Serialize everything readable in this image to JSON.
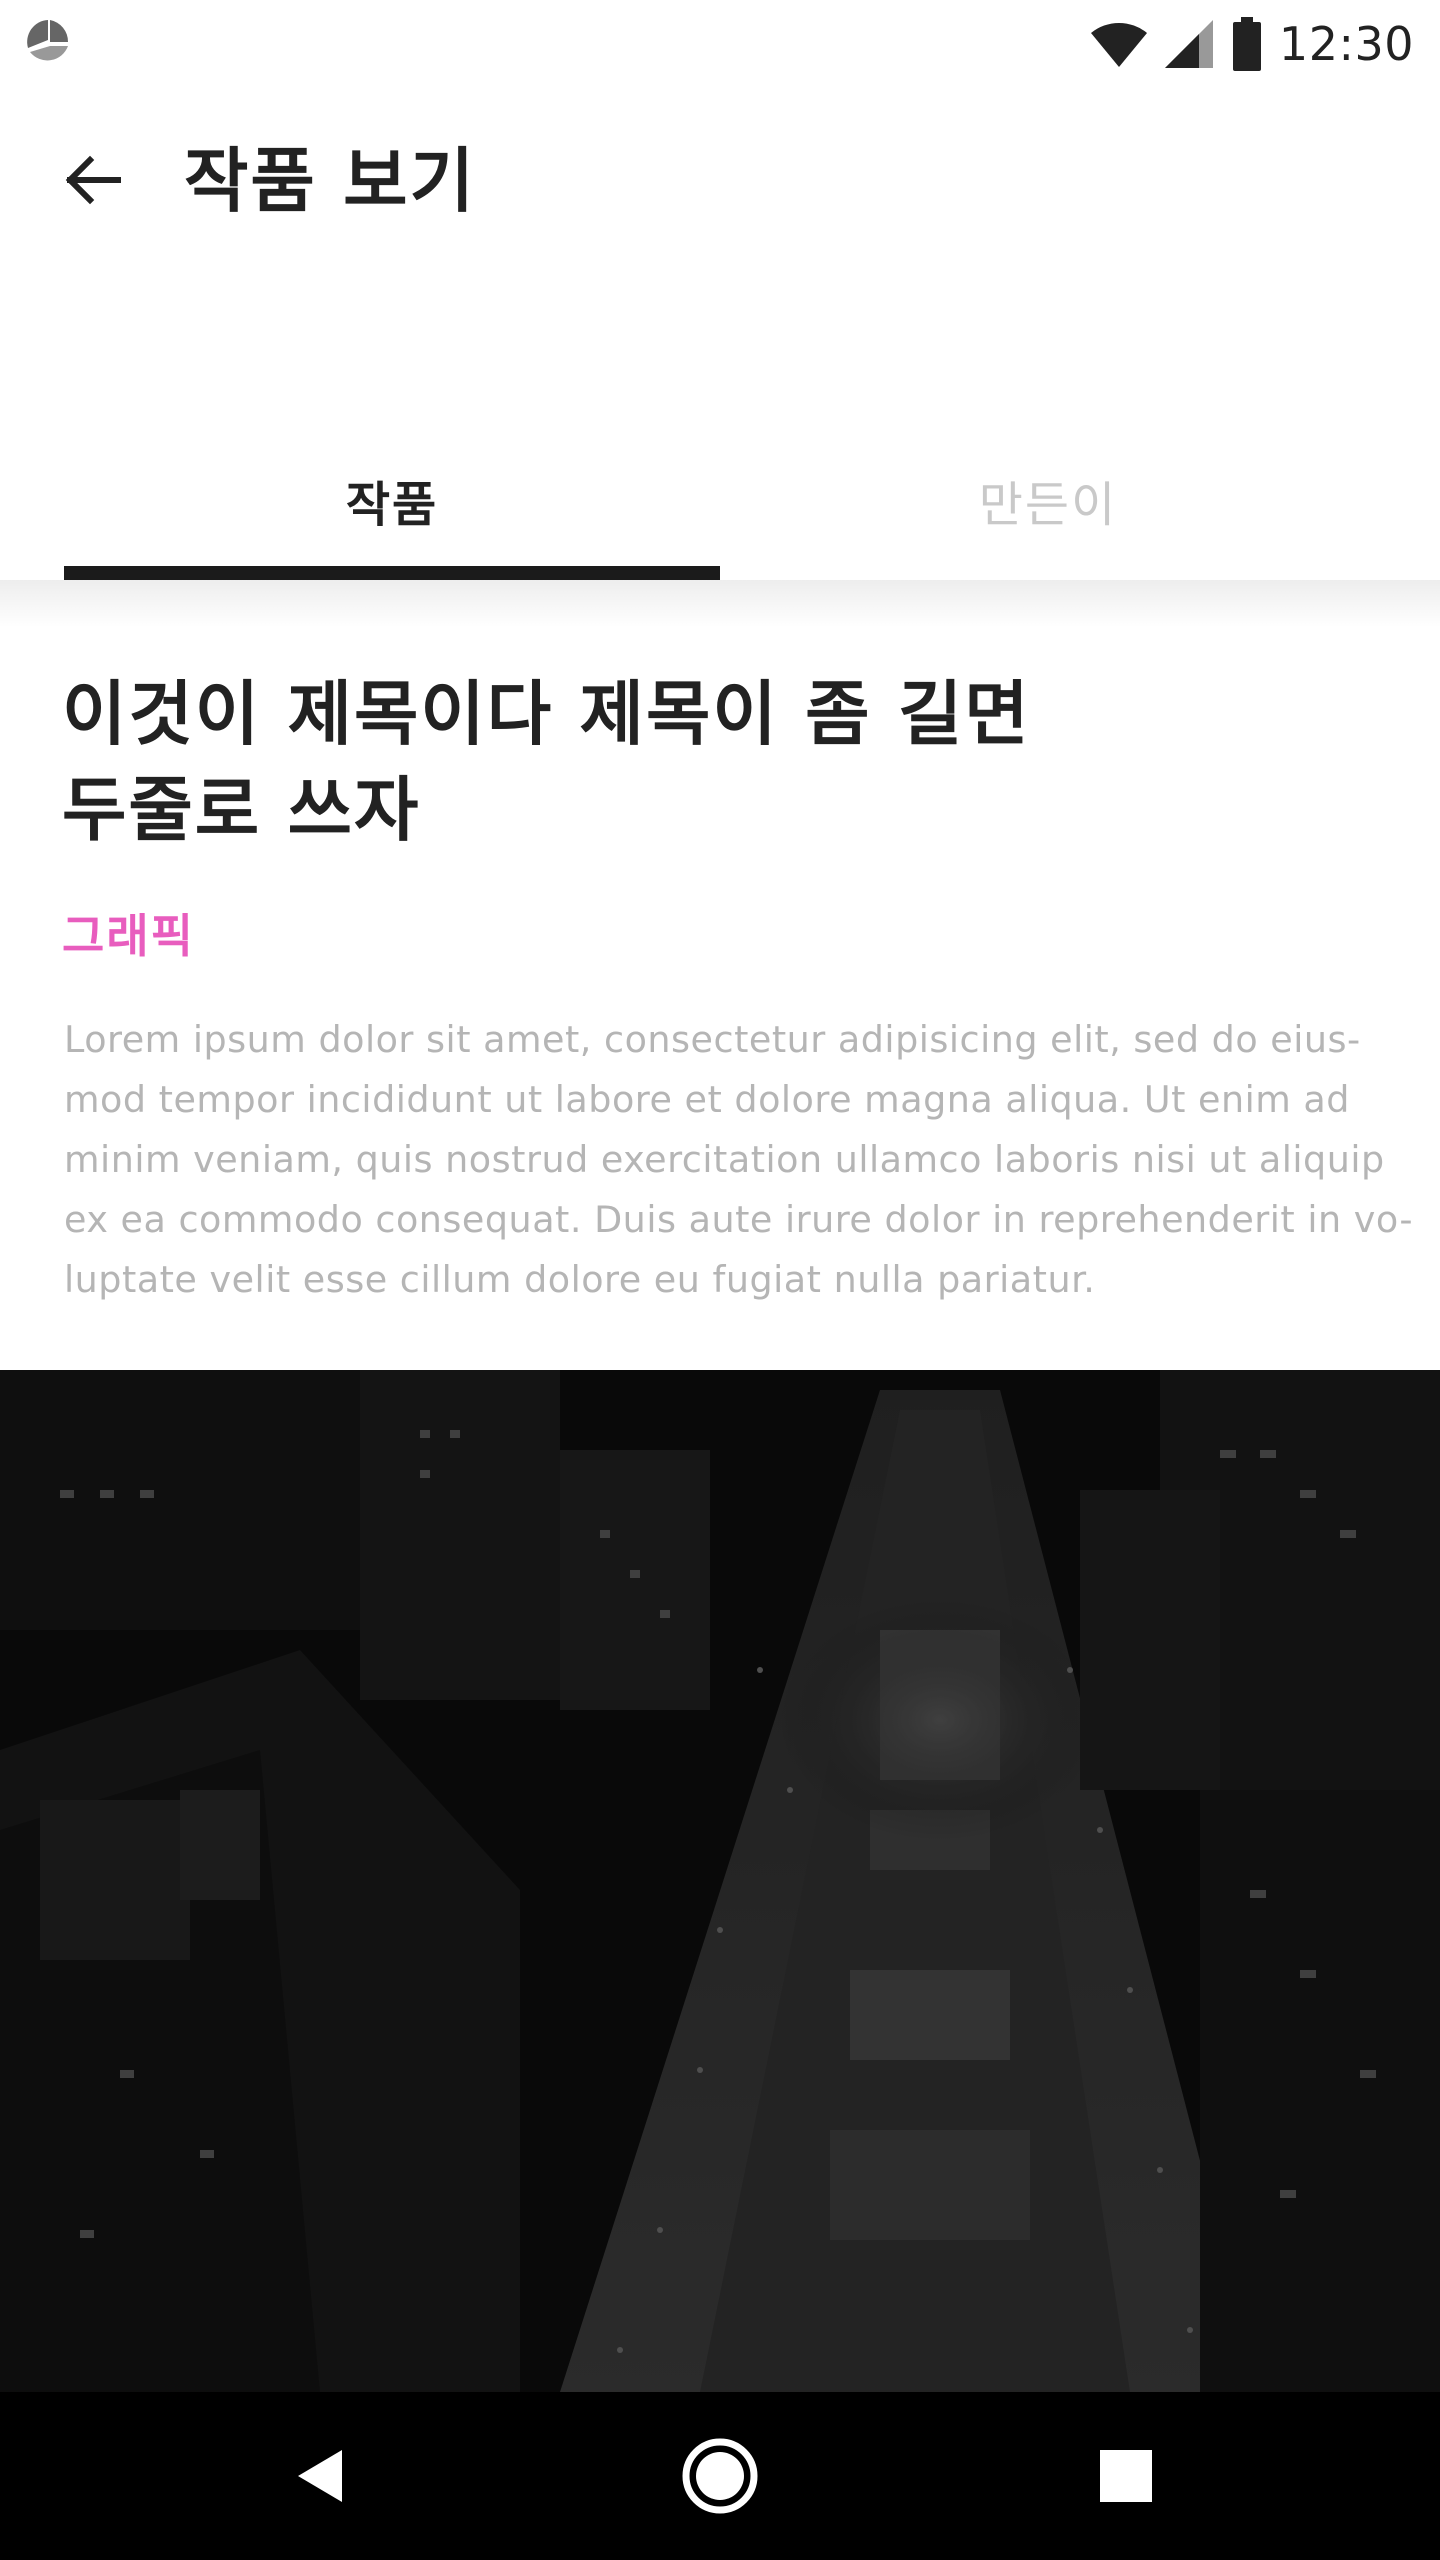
{
  "status_bar": {
    "time": "12:30",
    "icons": [
      "app-notification-icon",
      "wifi-icon",
      "signal-icon",
      "battery-icon"
    ]
  },
  "header": {
    "title": "작품 보기",
    "back_icon": "arrow-left-icon"
  },
  "tabs": [
    {
      "label": "작품",
      "selected": true
    },
    {
      "label": "만든이",
      "selected": false
    }
  ],
  "work": {
    "title_lines": [
      "이것이 제목이다 제목이 좀 길면",
      "두줄로 쓰자"
    ],
    "category": "그래픽",
    "description_lines": [
      "Lorem ipsum dolor sit amet, consectetur adipisicing elit, sed do eius-",
      "mod tempor incididunt ut labore et dolore magna aliqua. Ut enim ad",
      "minim veniam, quis nostrud exercitation ullamco laboris nisi ut aliquip",
      "ex ea commodo consequat. Duis aute irure dolor in reprehenderit in vo-",
      "luptate velit esse cillum dolore eu fugiat nulla pariatur."
    ],
    "image": "night-city-aerial-photo"
  },
  "nav_bar": {
    "icons": [
      "nav-back-icon",
      "nav-home-icon",
      "nav-recents-icon"
    ]
  },
  "colors": {
    "accent": "#e85dbe",
    "text_primary": "#222222",
    "text_muted": "#b5b5b5",
    "tab_inactive": "#c9c9c9",
    "tab_indicator": "#1b1b1b",
    "nav_background": "#000000"
  }
}
